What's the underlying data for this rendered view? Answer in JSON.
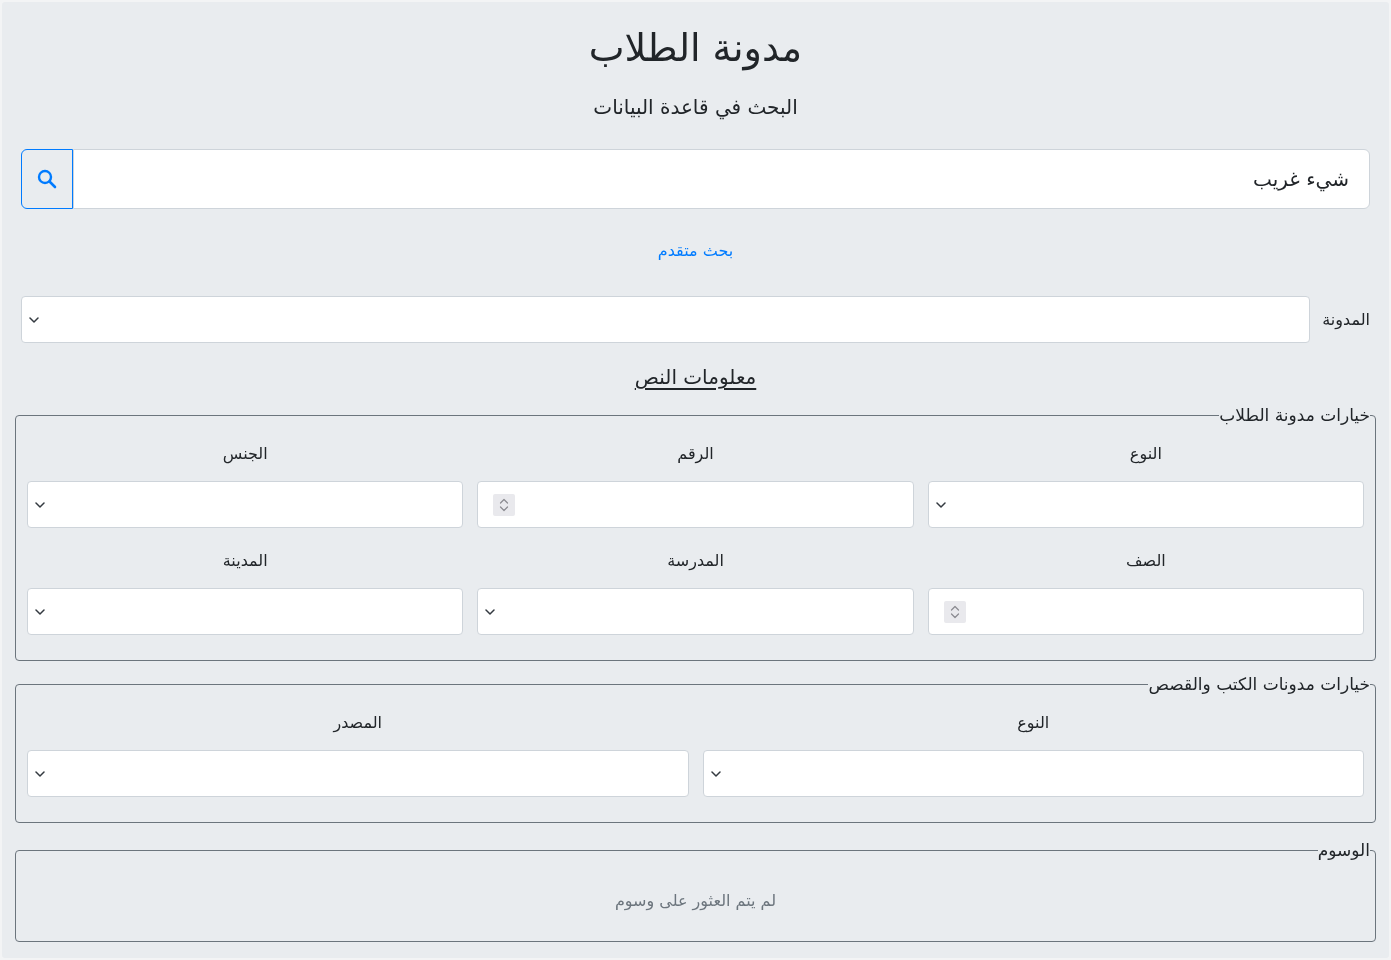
{
  "header": {
    "title": "مدونة الطلاب",
    "subtitle": "البحث في قاعدة البيانات"
  },
  "search": {
    "value": "شيء غريب"
  },
  "advanced_link": "بحث متقدم",
  "corpus": {
    "label": "المدونة"
  },
  "section_heading": "معلومات النص",
  "fieldsets": [
    {
      "legend": "خيارات مدونة الطلاب",
      "rows": [
        [
          {
            "label": "النوع",
            "kind": "select"
          },
          {
            "label": "الرقم",
            "kind": "number"
          },
          {
            "label": "الجنس",
            "kind": "select"
          }
        ],
        [
          {
            "label": "الصف",
            "kind": "number"
          },
          {
            "label": "المدرسة",
            "kind": "select"
          },
          {
            "label": "المدينة",
            "kind": "select"
          }
        ]
      ]
    },
    {
      "legend": "خيارات مدونات الكتب والقصص",
      "rows": [
        [
          {
            "label": "النوع",
            "kind": "select"
          },
          {
            "label": "المصدر",
            "kind": "select"
          }
        ]
      ]
    }
  ],
  "tags": {
    "legend": "الوسوم",
    "empty_message": "لم يتم العثور على وسوم"
  }
}
